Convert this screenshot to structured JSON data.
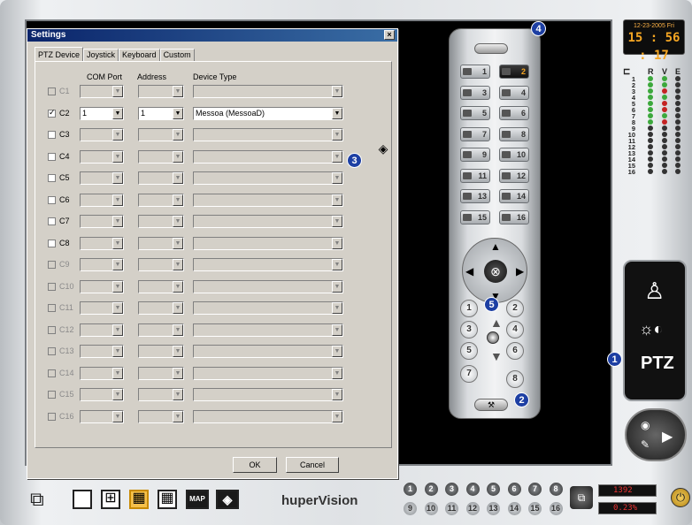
{
  "clock": {
    "date": "12-23-2005 Fri",
    "time": "15 : 56 : 17"
  },
  "status_header": {
    "r": "R",
    "v": "V",
    "e": "E"
  },
  "channels": [
    {
      "n": "1",
      "r": "green",
      "v": "green",
      "e": "dark"
    },
    {
      "n": "2",
      "r": "green",
      "v": "green",
      "e": "dark"
    },
    {
      "n": "3",
      "r": "green",
      "v": "red",
      "e": "dark"
    },
    {
      "n": "4",
      "r": "green",
      "v": "green",
      "e": "dark"
    },
    {
      "n": "5",
      "r": "green",
      "v": "red",
      "e": "dark"
    },
    {
      "n": "6",
      "r": "green",
      "v": "red",
      "e": "dark"
    },
    {
      "n": "7",
      "r": "green",
      "v": "green",
      "e": "dark"
    },
    {
      "n": "8",
      "r": "green",
      "v": "red",
      "e": "dark"
    },
    {
      "n": "9",
      "r": "dark",
      "v": "dark",
      "e": "dark"
    },
    {
      "n": "10",
      "r": "dark",
      "v": "dark",
      "e": "dark"
    },
    {
      "n": "11",
      "r": "dark",
      "v": "dark",
      "e": "dark"
    },
    {
      "n": "12",
      "r": "dark",
      "v": "dark",
      "e": "dark"
    },
    {
      "n": "13",
      "r": "dark",
      "v": "dark",
      "e": "dark"
    },
    {
      "n": "14",
      "r": "dark",
      "v": "dark",
      "e": "dark"
    },
    {
      "n": "15",
      "r": "dark",
      "v": "dark",
      "e": "dark"
    },
    {
      "n": "16",
      "r": "dark",
      "v": "dark",
      "e": "dark"
    }
  ],
  "mode_panel": {
    "ptz_label": "PTZ"
  },
  "dialog": {
    "title": "Settings",
    "close": "×",
    "tabs": [
      "PTZ Device",
      "Joystick",
      "Keyboard",
      "Custom"
    ],
    "columns": {
      "com_port": "COM Port",
      "address": "Address",
      "device_type": "Device Type"
    },
    "rows": [
      {
        "label": "C1",
        "checked": false,
        "enabled": false,
        "com": "",
        "addr": "",
        "device": ""
      },
      {
        "label": "C2",
        "checked": true,
        "enabled": true,
        "com": "1",
        "addr": "1",
        "device": "Messoa (MessoaD)"
      },
      {
        "label": "C3",
        "checked": false,
        "enabled": true,
        "com": "",
        "addr": "",
        "device": ""
      },
      {
        "label": "C4",
        "checked": false,
        "enabled": true,
        "com": "",
        "addr": "",
        "device": ""
      },
      {
        "label": "C5",
        "checked": false,
        "enabled": true,
        "com": "",
        "addr": "",
        "device": ""
      },
      {
        "label": "C6",
        "checked": false,
        "enabled": true,
        "com": "",
        "addr": "",
        "device": ""
      },
      {
        "label": "C7",
        "checked": false,
        "enabled": true,
        "com": "",
        "addr": "",
        "device": ""
      },
      {
        "label": "C8",
        "checked": false,
        "enabled": true,
        "com": "",
        "addr": "",
        "device": ""
      },
      {
        "label": "C9",
        "checked": false,
        "enabled": false,
        "com": "",
        "addr": "",
        "device": ""
      },
      {
        "label": "C10",
        "checked": false,
        "enabled": false,
        "com": "",
        "addr": "",
        "device": ""
      },
      {
        "label": "C11",
        "checked": false,
        "enabled": false,
        "com": "",
        "addr": "",
        "device": ""
      },
      {
        "label": "C12",
        "checked": false,
        "enabled": false,
        "com": "",
        "addr": "",
        "device": ""
      },
      {
        "label": "C13",
        "checked": false,
        "enabled": false,
        "com": "",
        "addr": "",
        "device": ""
      },
      {
        "label": "C14",
        "checked": false,
        "enabled": false,
        "com": "",
        "addr": "",
        "device": ""
      },
      {
        "label": "C15",
        "checked": false,
        "enabled": false,
        "com": "",
        "addr": "",
        "device": ""
      },
      {
        "label": "C16",
        "checked": false,
        "enabled": false,
        "com": "",
        "addr": "",
        "device": ""
      }
    ],
    "ok_label": "OK",
    "cancel_label": "Cancel"
  },
  "remote": {
    "cameras": [
      "1",
      "2",
      "3",
      "4",
      "5",
      "6",
      "7",
      "8",
      "9",
      "10",
      "11",
      "12",
      "13",
      "14",
      "15",
      "16"
    ],
    "active_camera": "2",
    "presets": [
      "1",
      "2",
      "3",
      "4",
      "5",
      "6",
      "7",
      "8"
    ],
    "dpad_center": "⊗"
  },
  "callouts": {
    "c1": "1",
    "c2": "2",
    "c3": "3",
    "c4": "4",
    "c5": "5"
  },
  "bottom": {
    "map_label": "MAP",
    "brand": "huperVision",
    "ch_buttons_row1": [
      "1",
      "2",
      "3",
      "4",
      "5",
      "6",
      "7",
      "8"
    ],
    "ch_buttons_row2": [
      "9",
      "10",
      "11",
      "12",
      "13",
      "14",
      "15",
      "16"
    ],
    "counter1": "1392",
    "counter2": "0.23%"
  },
  "colors": {
    "accent": "#1d3fa3",
    "clock": "#f5a623",
    "titlebar": "#0a246a"
  }
}
